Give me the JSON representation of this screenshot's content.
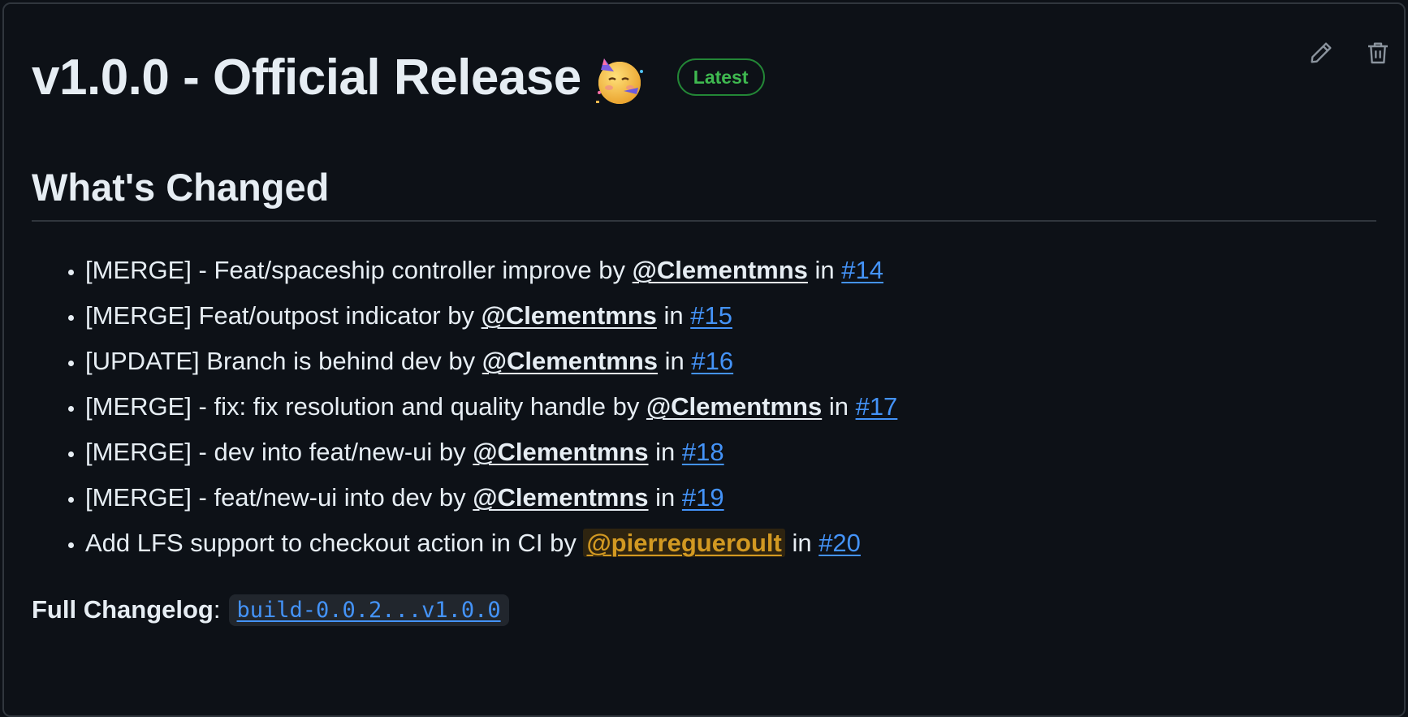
{
  "release": {
    "title": "v1.0.0 - Official Release",
    "emoji_icon": "partying-face-emoji",
    "badge": "Latest"
  },
  "actions": {
    "edit_icon": "pencil-icon",
    "delete_icon": "trash-icon"
  },
  "section": {
    "heading": "What's Changed"
  },
  "changes": [
    {
      "text": "[MERGE] - Feat/spaceship controller improve by ",
      "user": "@Clementmns",
      "in": " in ",
      "pr": "#14"
    },
    {
      "text": "[MERGE] Feat/outpost indicator by ",
      "user": "@Clementmns",
      "in": " in ",
      "pr": "#15"
    },
    {
      "text": "[UPDATE] Branch is behind dev by ",
      "user": "@Clementmns",
      "in": " in ",
      "pr": "#16"
    },
    {
      "text": "[MERGE] - fix: fix resolution and quality handle by ",
      "user": "@Clementmns",
      "in": " in ",
      "pr": "#17"
    },
    {
      "text": "[MERGE] - dev into feat/new-ui by ",
      "user": "@Clementmns",
      "in": " in ",
      "pr": "#18"
    },
    {
      "text": "[MERGE] - feat/new-ui into dev by ",
      "user": "@Clementmns",
      "in": " in ",
      "pr": "#19"
    },
    {
      "text": "Add LFS support to checkout action in CI by ",
      "user": "@pierregueroult",
      "in": " in ",
      "pr": "#20"
    }
  ],
  "changelog": {
    "label": "Full Changelog",
    "colon": ":",
    "compare": "build-0.0.2...v1.0.0"
  },
  "colors": {
    "background": "#0d1117",
    "text": "#e6edf3",
    "link": "#4493f8",
    "badge_green": "#3fb950",
    "highlight_user": "#d29922"
  }
}
